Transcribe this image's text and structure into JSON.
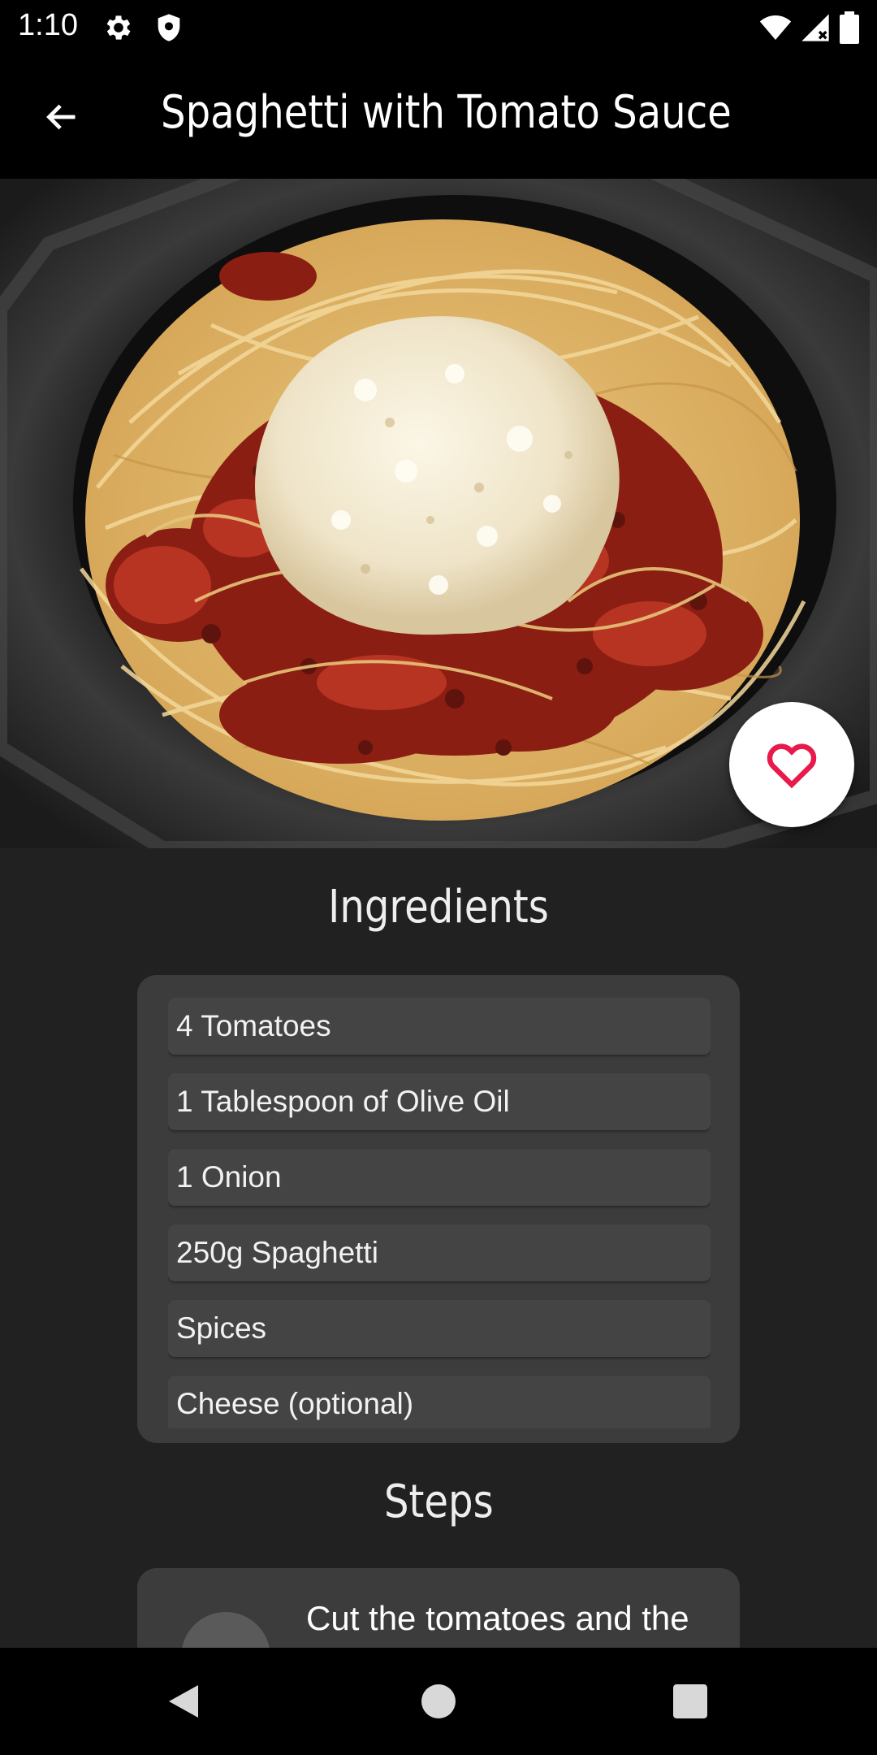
{
  "status_bar": {
    "time": "1:10",
    "icons": [
      "gear-icon",
      "shield-icon",
      "wifi-icon",
      "signal-icon",
      "battery-icon"
    ]
  },
  "app_bar": {
    "title": "Spaghetti with Tomato Sauce",
    "back_icon": "arrow-left-icon"
  },
  "favorite": {
    "icon": "heart-outline-icon",
    "color": "#e8194b"
  },
  "ingredients": {
    "title": "Ingredients",
    "items": [
      "4 Tomatoes",
      "1 Tablespoon of Olive Oil",
      "1 Onion",
      "250g Spaghetti",
      "Spices",
      "Cheese (optional)"
    ]
  },
  "steps": {
    "title": "Steps",
    "items": [
      {
        "text": "Cut the tomatoes and the onion into small"
      }
    ]
  },
  "nav": {
    "icons": [
      "back-triangle-icon",
      "home-circle-icon",
      "recents-square-icon"
    ]
  }
}
